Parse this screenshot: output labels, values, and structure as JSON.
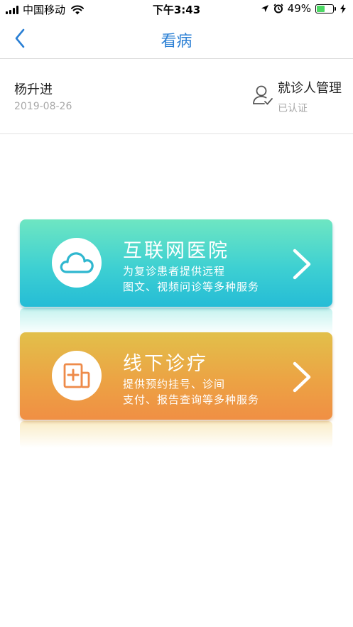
{
  "status_bar": {
    "carrier": "中国移动",
    "time": "下午3:43",
    "battery_percent": "49%",
    "battery_level": 0.49
  },
  "nav": {
    "title": "看病"
  },
  "patient": {
    "name": "杨升进",
    "date": "2019-08-26",
    "manage_label": "就诊人管理",
    "manage_status": "已认证"
  },
  "services": {
    "online": {
      "title": "互联网医院",
      "desc_line1": "为复诊患者提供远程",
      "desc_line2": "图文、视频问诊等多种服务",
      "icon": "cloud-icon",
      "color": "#2fc6d4"
    },
    "offline": {
      "title": "线下诊疗",
      "desc_line1": "提供预约挂号、诊间",
      "desc_line2": "支付、报告查询等多种服务",
      "icon": "hospital-icon",
      "color": "#ee9b44"
    }
  },
  "colors": {
    "accent": "#2a7fd4",
    "muted_text": "#a8a8a8"
  }
}
